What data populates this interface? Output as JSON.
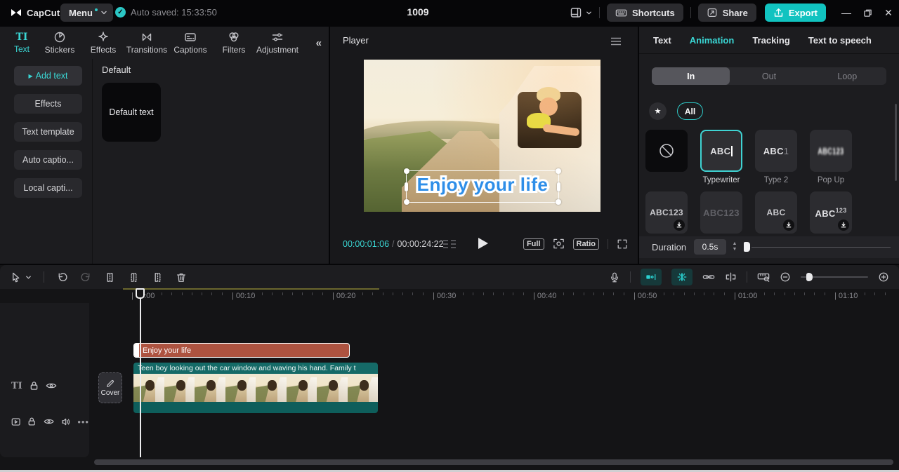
{
  "topbar": {
    "app_name": "CapCut",
    "menu_label": "Menu",
    "autosave_text": "Auto saved: 15:33:50",
    "project_title": "1009",
    "shortcuts_label": "Shortcuts",
    "share_label": "Share",
    "export_label": "Export",
    "accent_color": "#11c3c0"
  },
  "left_panel": {
    "tabs": [
      {
        "label": "Text",
        "icon": "text",
        "active": true
      },
      {
        "label": "Stickers",
        "icon": "stickers",
        "active": false
      },
      {
        "label": "Effects",
        "icon": "effects",
        "active": false
      },
      {
        "label": "Transitions",
        "icon": "transitions",
        "active": false
      },
      {
        "label": "Captions",
        "icon": "captions",
        "active": false
      },
      {
        "label": "Filters",
        "icon": "filters",
        "active": false
      },
      {
        "label": "Adjustment",
        "icon": "adjustment",
        "active": false
      }
    ],
    "collapse_glyph": "«",
    "sidebar_items": [
      {
        "label": "Add text",
        "active": true
      },
      {
        "label": "Effects",
        "active": false
      },
      {
        "label": "Text template",
        "active": false
      },
      {
        "label": "Auto captio...",
        "active": false
      },
      {
        "label": "Local capti...",
        "active": false
      }
    ],
    "section_title": "Default",
    "default_card_label": "Default text"
  },
  "player": {
    "title": "Player",
    "current_time": "00:00:01:06",
    "separator": "/",
    "total_time": "00:00:24:22",
    "overlay_text": "Enjoy your life",
    "full_label": "Full",
    "ratio_label": "Ratio",
    "overlay_color": "#2e8ee8"
  },
  "right_panel": {
    "tabs": [
      {
        "label": "Text",
        "active": false
      },
      {
        "label": "Animation",
        "active": true
      },
      {
        "label": "Tracking",
        "active": false
      },
      {
        "label": "Text to speech",
        "active": false
      }
    ],
    "segments": [
      {
        "label": "In",
        "active": true
      },
      {
        "label": "Out",
        "active": false
      },
      {
        "label": "Loop",
        "active": false
      }
    ],
    "star_glyph": "★",
    "filter_all_label": "All",
    "anim_row1": [
      {
        "name": "",
        "kind": "none"
      },
      {
        "name": "Typewriter",
        "kind": "caret",
        "text": "ABC",
        "selected": true
      },
      {
        "name": "Type 2",
        "kind": "suffix",
        "text": "ABC",
        "suffix": "1"
      },
      {
        "name": "Pop Up",
        "kind": "blur",
        "text": "ABC123"
      }
    ],
    "anim_row2": [
      {
        "kind": "plain",
        "text": "ABC123",
        "download": true
      },
      {
        "kind": "dim",
        "text": "ABC123",
        "download": false
      },
      {
        "kind": "plain",
        "text": "ABC",
        "download": true
      },
      {
        "kind": "sup",
        "text": "ABC",
        "sup": "123",
        "download": true
      }
    ],
    "duration_label": "Duration",
    "duration_value": "0.5s"
  },
  "timeline": {
    "ruler_labels": [
      "00:00",
      "00:10",
      "00:20",
      "00:30",
      "00:40",
      "00:50",
      "01:00",
      "01:10"
    ],
    "text_clip_label": "Enjoy your life",
    "video_clip_caption": "Teen boy looking out the car window and waving his hand. Family t",
    "cover_label": "Cover",
    "thumb_count": 8,
    "text_clip_color": "#ad5340",
    "video_clip_color": "#156a67"
  }
}
